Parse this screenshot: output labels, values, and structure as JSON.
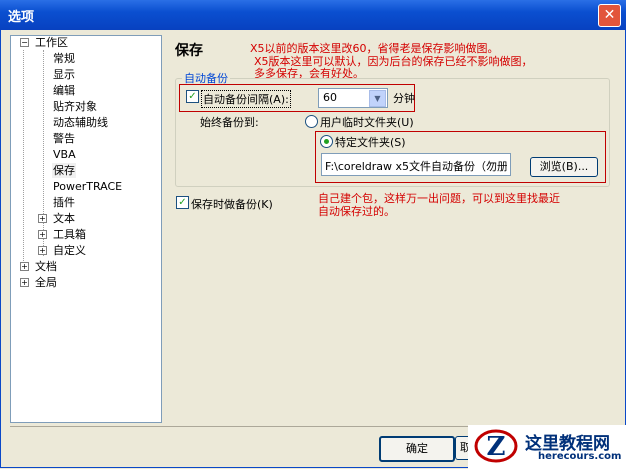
{
  "window": {
    "title": "选项",
    "close_glyph": "✕"
  },
  "tree": {
    "items": [
      {
        "label": "工作区",
        "expanded": true
      },
      {
        "label": "常规"
      },
      {
        "label": "显示"
      },
      {
        "label": "编辑"
      },
      {
        "label": "贴齐对象"
      },
      {
        "label": "动态辅助线"
      },
      {
        "label": "警告"
      },
      {
        "label": "VBA"
      },
      {
        "label": "保存",
        "selected": true
      },
      {
        "label": "PowerTRACE"
      },
      {
        "label": "插件"
      },
      {
        "label": "文本",
        "expandable": true
      },
      {
        "label": "工具箱",
        "expandable": true
      },
      {
        "label": "自定义",
        "expandable": true
      },
      {
        "label": "文档",
        "expandable": true
      },
      {
        "label": "全局",
        "expandable": true
      }
    ]
  },
  "panel": {
    "heading": "保存",
    "annotation_top_1": "X5以前的版本这里改60，省得老是保存影响做图。",
    "annotation_top_2": "X5版本这里可以默认，因为后台的保存已经不影响做图，",
    "annotation_top_3": "多多保存，会有好处。",
    "group_title": "自动备份",
    "auto_backup": {
      "label": "自动备份间隔(A):",
      "checked": true
    },
    "interval": {
      "value": "60",
      "unit": "分钟"
    },
    "always_backup_to": "始终备份到:",
    "radio_temp": {
      "label": "用户临时文件夹(U)",
      "selected": false
    },
    "radio_specific": {
      "label": "特定文件夹(S)",
      "selected": true
    },
    "folder_path": "F:\\coreldraw x5文件自动备份（勿册",
    "browse_label": "浏览(B)...",
    "save_backup": {
      "label": "保存时做备份(K)",
      "checked": true
    },
    "annotation_bottom_1": "自己建个包，这样万一出问题，可以到这里找最近",
    "annotation_bottom_2": "自动保存过的。"
  },
  "footer": {
    "ok_label": "确定",
    "cancel_label": "取消"
  },
  "watermark": {
    "title": "这里教程网",
    "url": "herecours.com",
    "logo_letter": "Z"
  },
  "colors": {
    "titlebar": "#0a4fd0",
    "annotation": "#d40000",
    "highlight_box": "#c00000",
    "check": "#21a121"
  }
}
